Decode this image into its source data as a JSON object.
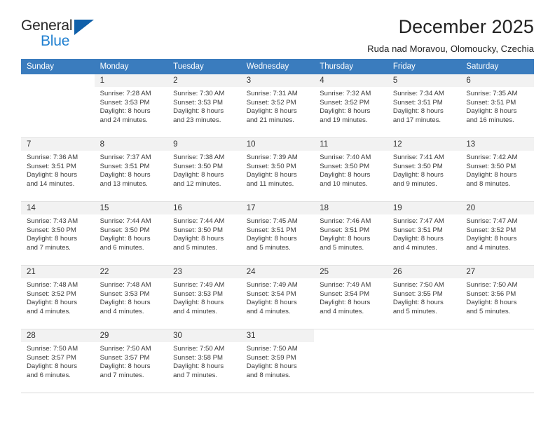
{
  "brand": {
    "name_top": "General",
    "name_bottom": "Blue",
    "accent_color": "#1f7fd0",
    "triangle_color": "#1060aa"
  },
  "header": {
    "title": "December 2025",
    "subtitle": "Ruda nad Moravou, Olomoucky, Czechia"
  },
  "theme": {
    "header_row_color": "#3a7cbe",
    "daynum_background": "#f2f2f2",
    "grid_line_color": "#d9d9d9"
  },
  "weekday_headers": [
    "Sunday",
    "Monday",
    "Tuesday",
    "Wednesday",
    "Thursday",
    "Friday",
    "Saturday"
  ],
  "weeks": [
    [
      {
        "day": "",
        "sunrise": "",
        "sunset": "",
        "daylight_line1": "",
        "daylight_line2": ""
      },
      {
        "day": "1",
        "sunrise": "Sunrise: 7:28 AM",
        "sunset": "Sunset: 3:53 PM",
        "daylight_line1": "Daylight: 8 hours",
        "daylight_line2": "and 24 minutes."
      },
      {
        "day": "2",
        "sunrise": "Sunrise: 7:30 AM",
        "sunset": "Sunset: 3:53 PM",
        "daylight_line1": "Daylight: 8 hours",
        "daylight_line2": "and 23 minutes."
      },
      {
        "day": "3",
        "sunrise": "Sunrise: 7:31 AM",
        "sunset": "Sunset: 3:52 PM",
        "daylight_line1": "Daylight: 8 hours",
        "daylight_line2": "and 21 minutes."
      },
      {
        "day": "4",
        "sunrise": "Sunrise: 7:32 AM",
        "sunset": "Sunset: 3:52 PM",
        "daylight_line1": "Daylight: 8 hours",
        "daylight_line2": "and 19 minutes."
      },
      {
        "day": "5",
        "sunrise": "Sunrise: 7:34 AM",
        "sunset": "Sunset: 3:51 PM",
        "daylight_line1": "Daylight: 8 hours",
        "daylight_line2": "and 17 minutes."
      },
      {
        "day": "6",
        "sunrise": "Sunrise: 7:35 AM",
        "sunset": "Sunset: 3:51 PM",
        "daylight_line1": "Daylight: 8 hours",
        "daylight_line2": "and 16 minutes."
      }
    ],
    [
      {
        "day": "7",
        "sunrise": "Sunrise: 7:36 AM",
        "sunset": "Sunset: 3:51 PM",
        "daylight_line1": "Daylight: 8 hours",
        "daylight_line2": "and 14 minutes."
      },
      {
        "day": "8",
        "sunrise": "Sunrise: 7:37 AM",
        "sunset": "Sunset: 3:51 PM",
        "daylight_line1": "Daylight: 8 hours",
        "daylight_line2": "and 13 minutes."
      },
      {
        "day": "9",
        "sunrise": "Sunrise: 7:38 AM",
        "sunset": "Sunset: 3:50 PM",
        "daylight_line1": "Daylight: 8 hours",
        "daylight_line2": "and 12 minutes."
      },
      {
        "day": "10",
        "sunrise": "Sunrise: 7:39 AM",
        "sunset": "Sunset: 3:50 PM",
        "daylight_line1": "Daylight: 8 hours",
        "daylight_line2": "and 11 minutes."
      },
      {
        "day": "11",
        "sunrise": "Sunrise: 7:40 AM",
        "sunset": "Sunset: 3:50 PM",
        "daylight_line1": "Daylight: 8 hours",
        "daylight_line2": "and 10 minutes."
      },
      {
        "day": "12",
        "sunrise": "Sunrise: 7:41 AM",
        "sunset": "Sunset: 3:50 PM",
        "daylight_line1": "Daylight: 8 hours",
        "daylight_line2": "and 9 minutes."
      },
      {
        "day": "13",
        "sunrise": "Sunrise: 7:42 AM",
        "sunset": "Sunset: 3:50 PM",
        "daylight_line1": "Daylight: 8 hours",
        "daylight_line2": "and 8 minutes."
      }
    ],
    [
      {
        "day": "14",
        "sunrise": "Sunrise: 7:43 AM",
        "sunset": "Sunset: 3:50 PM",
        "daylight_line1": "Daylight: 8 hours",
        "daylight_line2": "and 7 minutes."
      },
      {
        "day": "15",
        "sunrise": "Sunrise: 7:44 AM",
        "sunset": "Sunset: 3:50 PM",
        "daylight_line1": "Daylight: 8 hours",
        "daylight_line2": "and 6 minutes."
      },
      {
        "day": "16",
        "sunrise": "Sunrise: 7:44 AM",
        "sunset": "Sunset: 3:50 PM",
        "daylight_line1": "Daylight: 8 hours",
        "daylight_line2": "and 5 minutes."
      },
      {
        "day": "17",
        "sunrise": "Sunrise: 7:45 AM",
        "sunset": "Sunset: 3:51 PM",
        "daylight_line1": "Daylight: 8 hours",
        "daylight_line2": "and 5 minutes."
      },
      {
        "day": "18",
        "sunrise": "Sunrise: 7:46 AM",
        "sunset": "Sunset: 3:51 PM",
        "daylight_line1": "Daylight: 8 hours",
        "daylight_line2": "and 5 minutes."
      },
      {
        "day": "19",
        "sunrise": "Sunrise: 7:47 AM",
        "sunset": "Sunset: 3:51 PM",
        "daylight_line1": "Daylight: 8 hours",
        "daylight_line2": "and 4 minutes."
      },
      {
        "day": "20",
        "sunrise": "Sunrise: 7:47 AM",
        "sunset": "Sunset: 3:52 PM",
        "daylight_line1": "Daylight: 8 hours",
        "daylight_line2": "and 4 minutes."
      }
    ],
    [
      {
        "day": "21",
        "sunrise": "Sunrise: 7:48 AM",
        "sunset": "Sunset: 3:52 PM",
        "daylight_line1": "Daylight: 8 hours",
        "daylight_line2": "and 4 minutes."
      },
      {
        "day": "22",
        "sunrise": "Sunrise: 7:48 AM",
        "sunset": "Sunset: 3:53 PM",
        "daylight_line1": "Daylight: 8 hours",
        "daylight_line2": "and 4 minutes."
      },
      {
        "day": "23",
        "sunrise": "Sunrise: 7:49 AM",
        "sunset": "Sunset: 3:53 PM",
        "daylight_line1": "Daylight: 8 hours",
        "daylight_line2": "and 4 minutes."
      },
      {
        "day": "24",
        "sunrise": "Sunrise: 7:49 AM",
        "sunset": "Sunset: 3:54 PM",
        "daylight_line1": "Daylight: 8 hours",
        "daylight_line2": "and 4 minutes."
      },
      {
        "day": "25",
        "sunrise": "Sunrise: 7:49 AM",
        "sunset": "Sunset: 3:54 PM",
        "daylight_line1": "Daylight: 8 hours",
        "daylight_line2": "and 4 minutes."
      },
      {
        "day": "26",
        "sunrise": "Sunrise: 7:50 AM",
        "sunset": "Sunset: 3:55 PM",
        "daylight_line1": "Daylight: 8 hours",
        "daylight_line2": "and 5 minutes."
      },
      {
        "day": "27",
        "sunrise": "Sunrise: 7:50 AM",
        "sunset": "Sunset: 3:56 PM",
        "daylight_line1": "Daylight: 8 hours",
        "daylight_line2": "and 5 minutes."
      }
    ],
    [
      {
        "day": "28",
        "sunrise": "Sunrise: 7:50 AM",
        "sunset": "Sunset: 3:57 PM",
        "daylight_line1": "Daylight: 8 hours",
        "daylight_line2": "and 6 minutes."
      },
      {
        "day": "29",
        "sunrise": "Sunrise: 7:50 AM",
        "sunset": "Sunset: 3:57 PM",
        "daylight_line1": "Daylight: 8 hours",
        "daylight_line2": "and 7 minutes."
      },
      {
        "day": "30",
        "sunrise": "Sunrise: 7:50 AM",
        "sunset": "Sunset: 3:58 PM",
        "daylight_line1": "Daylight: 8 hours",
        "daylight_line2": "and 7 minutes."
      },
      {
        "day": "31",
        "sunrise": "Sunrise: 7:50 AM",
        "sunset": "Sunset: 3:59 PM",
        "daylight_line1": "Daylight: 8 hours",
        "daylight_line2": "and 8 minutes."
      },
      {
        "day": "",
        "sunrise": "",
        "sunset": "",
        "daylight_line1": "",
        "daylight_line2": ""
      },
      {
        "day": "",
        "sunrise": "",
        "sunset": "",
        "daylight_line1": "",
        "daylight_line2": ""
      },
      {
        "day": "",
        "sunrise": "",
        "sunset": "",
        "daylight_line1": "",
        "daylight_line2": ""
      }
    ]
  ]
}
